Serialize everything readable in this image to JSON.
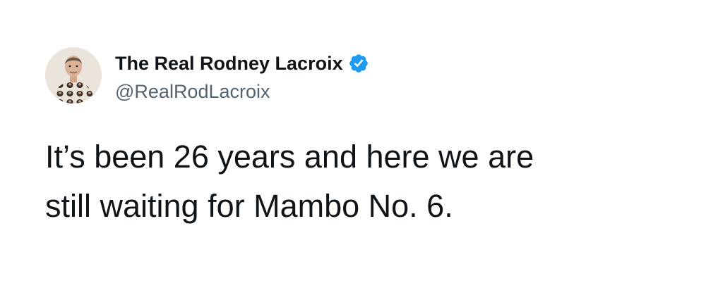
{
  "author": {
    "display_name": "The Real Rodney Lacroix",
    "handle": "@RealRodLacroix",
    "verified": true,
    "avatar_icon": "profile-photo",
    "badge_icon": "verified-check-icon"
  },
  "tweet": {
    "text": "It’s been 26 years and here we are\nstill waiting for Mambo No. 6."
  },
  "colors": {
    "text_primary": "#0f1419",
    "text_secondary": "#536471",
    "verified_blue": "#1d9bf0",
    "background": "#ffffff"
  }
}
